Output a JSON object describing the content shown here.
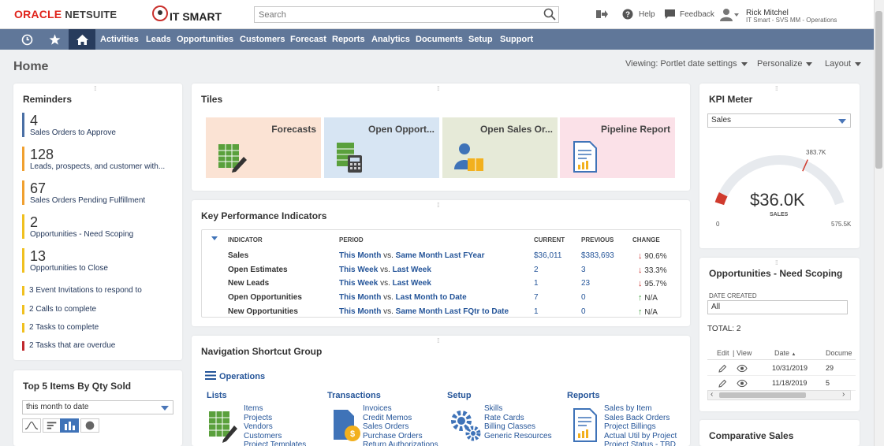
{
  "header": {
    "logo_oracle": "ORACLE",
    "logo_netsuite": "NETSUITE",
    "logo_company": "IT SMART",
    "search_placeholder": "Search",
    "help": "Help",
    "feedback": "Feedback",
    "user_name": "Rick Mitchel",
    "user_role": "IT Smart - SVS MM - Operations"
  },
  "nav": {
    "items": [
      "Activities",
      "Leads",
      "Opportunities",
      "Customers",
      "Forecast",
      "Reports",
      "Analytics",
      "Documents",
      "Setup",
      "Support"
    ]
  },
  "page": {
    "title": "Home",
    "viewing": "Viewing: Portlet date settings",
    "personalize": "Personalize",
    "layout": "Layout"
  },
  "reminders": {
    "title": "Reminders",
    "big": [
      {
        "count": "4",
        "label": "Sales Orders to Approve",
        "color": "#4a6fa5"
      },
      {
        "count": "128",
        "label": "Leads, prospects, and customer with...",
        "color": "#f0a030"
      },
      {
        "count": "67",
        "label": "Sales Orders Pending Fulfillment",
        "color": "#f0a030"
      },
      {
        "count": "2",
        "label": "Opportunities - Need Scoping",
        "color": "#f0c020"
      },
      {
        "count": "13",
        "label": "Opportunities to Close",
        "color": "#f0c020"
      }
    ],
    "small": [
      {
        "label": "3  Event Invitations to respond to",
        "color": "#f0c020"
      },
      {
        "label": "2  Calls to complete",
        "color": "#f0c020"
      },
      {
        "label": "2  Tasks to complete",
        "color": "#f0c020"
      },
      {
        "label": "2  Tasks that are overdue",
        "color": "#c0282d"
      }
    ]
  },
  "top5": {
    "title": "Top 5 Items By Qty Sold",
    "period": "this month to date"
  },
  "tiles": {
    "title": "Tiles",
    "items": [
      {
        "label": "Forecasts",
        "bg": "#fbe3d4"
      },
      {
        "label": "Open Opport...",
        "bg": "#d7e5f3"
      },
      {
        "label": "Open Sales Or...",
        "bg": "#e6ead8"
      },
      {
        "label": "Pipeline Report",
        "bg": "#fbe1e8"
      }
    ]
  },
  "kpi": {
    "title": "Key Performance Indicators",
    "headers": {
      "indicator": "INDICATOR",
      "period": "PERIOD",
      "current": "CURRENT",
      "previous": "PREVIOUS",
      "change": "CHANGE"
    },
    "rows": [
      {
        "indicator": "Sales",
        "p1": "This Month",
        "vs": "vs.",
        "p2": "Same Month Last FYear",
        "current": "$36,011",
        "previous": "$383,693",
        "change": "90.6%",
        "dir": "down"
      },
      {
        "indicator": "Open Estimates",
        "p1": "This Week",
        "vs": "vs.",
        "p2": "Last Week",
        "current": "2",
        "previous": "3",
        "change": "33.3%",
        "dir": "down"
      },
      {
        "indicator": "New Leads",
        "p1": "This Week",
        "vs": "vs.",
        "p2": "Last Week",
        "current": "1",
        "previous": "23",
        "change": "95.7%",
        "dir": "down"
      },
      {
        "indicator": "Open Opportunities",
        "p1": "This Month",
        "vs": "vs.",
        "p2": "Last Month to Date",
        "current": "7",
        "previous": "0",
        "change": "N/A",
        "dir": "up"
      },
      {
        "indicator": "New Opportunities",
        "p1": "This Month",
        "vs": "vs.",
        "p2": "Same Month Last FQtr to Date",
        "current": "1",
        "previous": "0",
        "change": "N/A",
        "dir": "up"
      }
    ]
  },
  "shortcuts": {
    "title": "Navigation Shortcut Group",
    "group": "Operations",
    "columns": [
      {
        "head": "Lists",
        "links": [
          "Items",
          "Projects",
          "Vendors",
          "Customers",
          "Project Templates"
        ]
      },
      {
        "head": "Transactions",
        "links": [
          "Invoices",
          "Credit Memos",
          "Sales Orders",
          "Purchase Orders",
          "Return Authorizations"
        ]
      },
      {
        "head": "Setup",
        "links": [
          "Skills",
          "Rate Cards",
          "Billing Classes",
          "Generic Resources"
        ]
      },
      {
        "head": "Reports",
        "links": [
          "Sales by Item",
          "Sales Back Orders",
          "Project Billings",
          "Actual Util by Project",
          "Project Status - TBD"
        ]
      }
    ]
  },
  "kpi_meter": {
    "title": "KPI Meter",
    "select": "Sales",
    "value": "$36.0K",
    "label": "SALES",
    "min": "0",
    "max": "575.5K",
    "target": "383.7K",
    "fraction": 0.0626,
    "target_fraction": 0.6667
  },
  "opps_scoping": {
    "title": "Opportunities - Need Scoping",
    "date_created_label": "DATE CREATED",
    "date_created_value": "All",
    "total_label": "TOTAL:",
    "total_value": "2",
    "col_edit": "Edit",
    "col_sep": "|",
    "col_view": "View",
    "col_date": "Date",
    "col_doc": "Docume",
    "rows": [
      {
        "date": "10/31/2019",
        "doc": "29"
      },
      {
        "date": "11/18/2019",
        "doc": "5"
      }
    ]
  },
  "comparative": {
    "title": "Comparative Sales"
  }
}
